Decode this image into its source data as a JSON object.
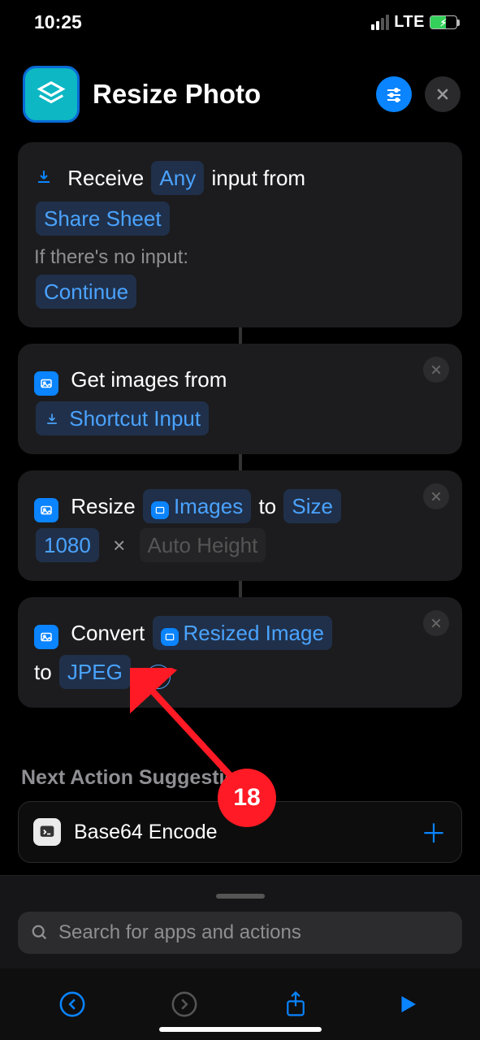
{
  "status": {
    "time": "10:25",
    "network": "LTE"
  },
  "header": {
    "title": "Resize Photo"
  },
  "receive": {
    "prefix": "Receive",
    "type": "Any",
    "mid": "input from",
    "source": "Share Sheet",
    "noinput_label": "If there's no input:",
    "noinput_action": "Continue"
  },
  "getimages": {
    "label": "Get images from",
    "source": "Shortcut Input"
  },
  "resize": {
    "label": "Resize",
    "var": "Images",
    "to": "to",
    "sizelabel": "Size",
    "width": "1080",
    "times": "×",
    "height": "Auto Height"
  },
  "convert": {
    "label": "Convert",
    "var": "Resized Image",
    "to": "to",
    "format": "JPEG"
  },
  "suggestions": {
    "header": "Next Action Suggestions",
    "items": [
      {
        "label": "Base64 Encode"
      }
    ]
  },
  "search": {
    "placeholder": "Search for apps and actions"
  },
  "annotation": {
    "label": "18"
  }
}
